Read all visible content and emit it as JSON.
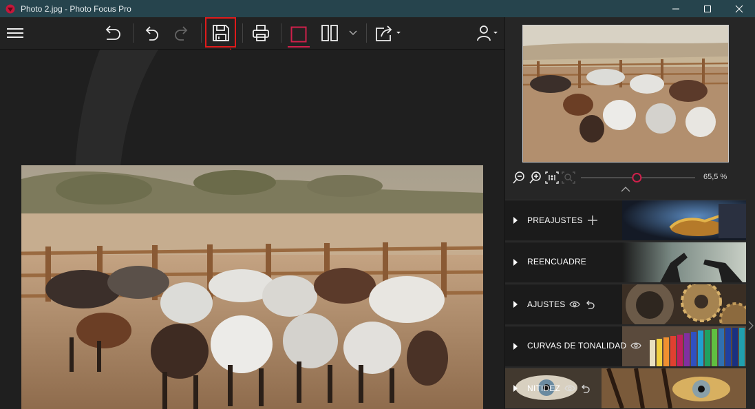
{
  "window": {
    "title": "Photo 2.jpg - Photo Focus Pro"
  },
  "toolbar": {
    "items": [
      "menu-icon",
      "undo-all-icon",
      "undo-icon",
      "redo-icon",
      "save-icon",
      "print-icon",
      "single-view-icon",
      "split-view-icon",
      "share-icon",
      "user-icon"
    ]
  },
  "navigator": {
    "zoom_value": "65,5 %",
    "zoom_level": 0.49
  },
  "panels": [
    {
      "label": "PREAJUSTES",
      "extra": "plus"
    },
    {
      "label": "REENCUADRE",
      "extra": ""
    },
    {
      "label": "AJUSTES",
      "extra": "eye-reset"
    },
    {
      "label": "CURVAS DE TONALIDAD",
      "extra": "eye"
    },
    {
      "label": "NITIDEZ",
      "extra": "eye-reset"
    }
  ],
  "colors": {
    "titlebar": "#26444d",
    "accent": "#d0204b",
    "highlight": "#e01b1b"
  }
}
